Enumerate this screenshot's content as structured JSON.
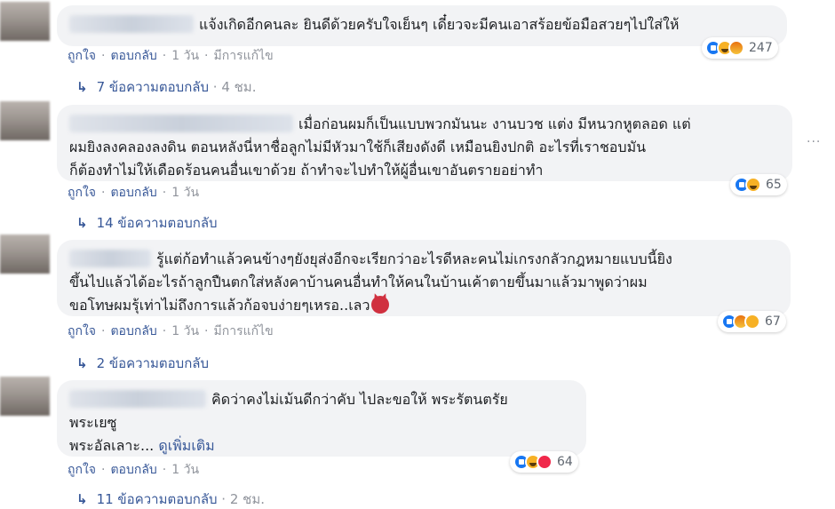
{
  "comments": [
    {
      "text": "แจ้งเกิดอีกคนละ ยินดีด้วยครับใจเย็นๆ เดี๋ยวจะมีคนเอาสร้อยข้อมือสวยๆไปใส่ให้",
      "like": "ถูกใจ",
      "reply": "ตอบกลับ",
      "time": "1 วัน",
      "edited": "มีการแก้ไข",
      "reaction_count": "247",
      "replies": "7 ข้อความตอบกลับ",
      "replies_time": "4 ชม."
    },
    {
      "text_lines": [
        "เมื่อก่อนผมก็เป็นแบบพวกมันนะ งานบวช แต่ง มีหนวกหูตลอด แต่",
        "ผมยิงลงคลองลงดิน ตอนหลังนี่หาชื่อลูกไม่มีหัวมาใช้ก็เสียงดังดี เหมือนยิงปกติ อะไรที่เราชอบมัน",
        "ก็ต้องทำไม่ให้เดือดร้อนคนอื่นเขาด้วย ถ้าทำจะไปทำให้ผู้อื่นเขาอันตรายอย่าทำ"
      ],
      "like": "ถูกใจ",
      "reply": "ตอบกลับ",
      "time": "1 วัน",
      "reaction_count": "65",
      "replies": "14 ข้อความตอบกลับ"
    },
    {
      "text_lines": [
        "รู้แต่ก้อทำแล้วคนข้างๆยังยุส่งอีกจะเรียกว่าอะไรดีหละคนไม่เกรงกลัวกฎหมายแบบนี้ยิง",
        "ขึ้นไปแล้วได้อะไรถ้าลูกปืนตกใส่หลังคาบ้านคนอื่นทำให้คนในบ้านเค้าตายขึ้นมาแล้วมาพูดว่าผม",
        "ขอโทษผมรุ้เท่าไม่ถึงการแล้วก้อจบง่ายๆเหรอ..เลว"
      ],
      "like": "ถูกใจ",
      "reply": "ตอบกลับ",
      "time": "1 วัน",
      "edited": "มีการแก้ไข",
      "reaction_count": "67",
      "replies": "2 ข้อความตอบกลับ"
    },
    {
      "text_lines": [
        "คิดว่าคงไม่เม้นดีกว่าคับ ไปละขอให้ พระรัตนตรัย",
        "พระเยซู",
        "พระอัลเลาะ..."
      ],
      "see_more": "ดูเพิ่มเติม",
      "like": "ถูกใจ",
      "reply": "ตอบกลับ",
      "time": "1 วัน",
      "reaction_count": "64",
      "replies": "11 ข้อความตอบกลับ",
      "replies_time": "2 ชม."
    }
  ],
  "more_options": "···",
  "icons": [
    "like-icon",
    "angry-icon",
    "haha-icon",
    "sad-icon",
    "love-icon",
    "devil-emoji-icon",
    "reply-arrow-icon"
  ],
  "colors": {
    "link": "#385898",
    "meta": "#90949c",
    "bubble": "#f2f3f5",
    "like": "#1877f2"
  }
}
